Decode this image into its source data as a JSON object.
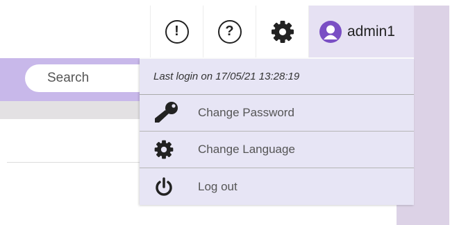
{
  "header": {
    "alert_icon": "exclamation-circle-icon",
    "alert_glyph": "!",
    "help_icon": "question-circle-icon",
    "help_glyph": "?",
    "settings_icon": "gear-icon",
    "user": {
      "icon": "user-avatar-icon",
      "name": "admin1"
    }
  },
  "search": {
    "placeholder": "Search"
  },
  "user_menu": {
    "last_login": "Last login on 17/05/21 13:28:19",
    "items": [
      {
        "label": "Change Password",
        "icon": "key-icon"
      },
      {
        "label": "Change Language",
        "icon": "gear-icon"
      },
      {
        "label": "Log out",
        "icon": "power-icon"
      }
    ]
  },
  "colors": {
    "accent": "#7a4fc4",
    "search_band": "#c8b8ea",
    "menu_background": "#e7e5f5",
    "side_panel": "#dcd2e6"
  }
}
